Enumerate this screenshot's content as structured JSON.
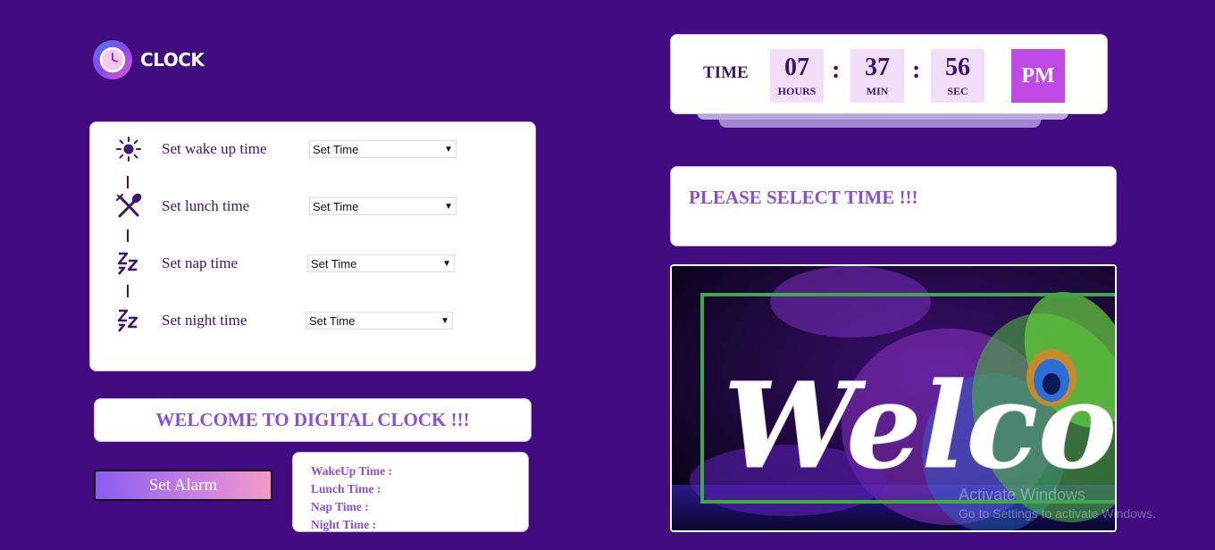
{
  "logo": {
    "text": "CLOCK",
    "icon": "clock-icon"
  },
  "schedule": {
    "items": [
      {
        "icon": "sun-icon",
        "label": "Set wake up time",
        "select_value": "Set Time"
      },
      {
        "icon": "fork-spoon-icon",
        "label": "Set lunch time",
        "select_value": "Set Time"
      },
      {
        "icon": "sleep-zz-icon",
        "label": "Set nap time",
        "select_value": "Set Time"
      },
      {
        "icon": "sleep-zz-icon",
        "label": "Set night time",
        "select_value": "Set Time"
      }
    ]
  },
  "welcome_banner": "WELCOME TO DIGITAL CLOCK !!!",
  "alarm_button": "Set Alarm",
  "times_summary": {
    "wakeup": "WakeUp Time :",
    "lunch": "Lunch Time :",
    "nap": "Nap Time :",
    "night": "Night Time :"
  },
  "clock": {
    "label": "TIME",
    "hours": "07",
    "hours_label": "HOURS",
    "minutes": "37",
    "minutes_label": "MIN",
    "seconds": "56",
    "seconds_label": "SEC",
    "separator": ":",
    "ampm": "PM"
  },
  "message": "PLEASE SELECT TIME !!!",
  "image": {
    "text": "Welcome"
  },
  "watermark": {
    "line1": "Activate Windows",
    "line2": "Go to Settings to activate Windows."
  },
  "colors": {
    "background": "#420b7f",
    "accent": "#8a4fd6",
    "ampm": "#c14ae6",
    "dark_text": "#3d1570"
  }
}
